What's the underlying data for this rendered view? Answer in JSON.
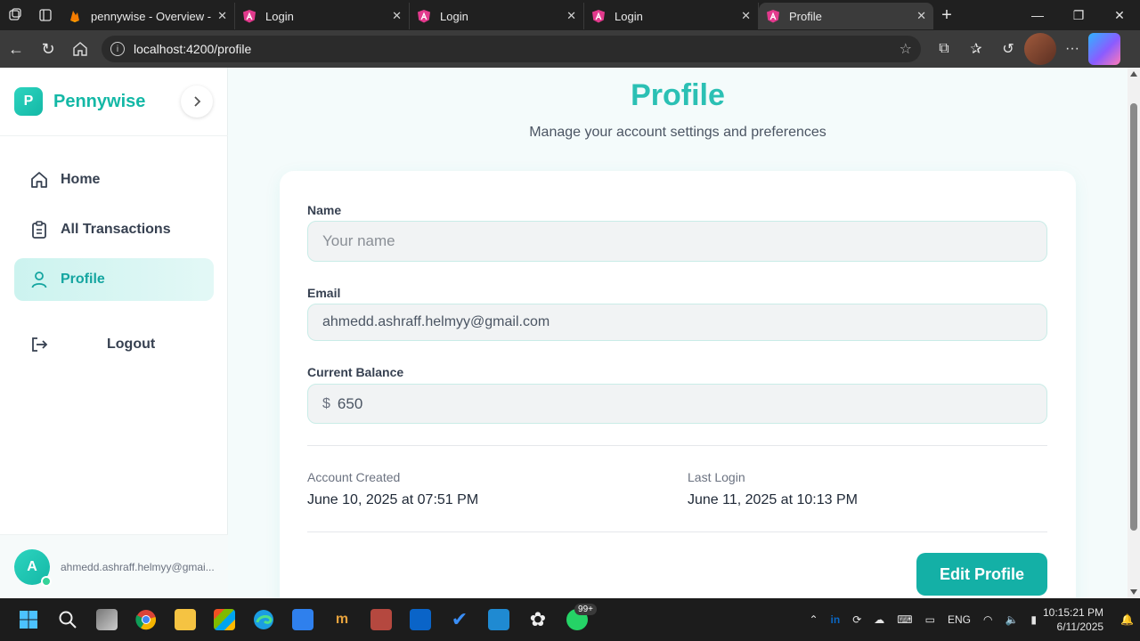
{
  "browser": {
    "tabs": [
      {
        "title": "pennywise - Overview - Fi",
        "active": false
      },
      {
        "title": "Login",
        "active": false
      },
      {
        "title": "Login",
        "active": false
      },
      {
        "title": "Login",
        "active": false
      },
      {
        "title": "Profile",
        "active": true
      }
    ],
    "url": "localhost:4200/profile"
  },
  "sidebar": {
    "brand_letter": "P",
    "brand_name": "Pennywise",
    "items": [
      {
        "label": "Home",
        "icon": "home-icon",
        "active": false
      },
      {
        "label": "All Transactions",
        "icon": "clipboard-icon",
        "active": false
      },
      {
        "label": "Profile",
        "icon": "user-icon",
        "active": true
      }
    ],
    "logout_label": "Logout",
    "user": {
      "initial": "A",
      "email": "ahmedd.ashraff.helmyy@gmai..."
    }
  },
  "main": {
    "title": "Profile",
    "subtitle": "Manage your account settings and preferences",
    "form": {
      "name_label": "Name",
      "name_placeholder": "Your name",
      "email_label": "Email",
      "email_value": "ahmedd.ashraff.helmyy@gmail.com",
      "balance_label": "Current Balance",
      "currency": "$",
      "balance_value": "650"
    },
    "meta": {
      "created_label": "Account Created",
      "created_value": "June 10, 2025 at 07:51 PM",
      "last_login_label": "Last Login",
      "last_login_value": "June 11, 2025 at 10:13 PM"
    },
    "edit_button": "Edit Profile"
  },
  "taskbar": {
    "whatsapp_badge": "99+",
    "language": "ENG",
    "time": "10:15:21 PM",
    "date": "6/11/2025"
  },
  "colors": {
    "accent": "#14b8a6",
    "accent_dark": "#14b0a6",
    "active_nav_bg": "#ccf3ef"
  }
}
